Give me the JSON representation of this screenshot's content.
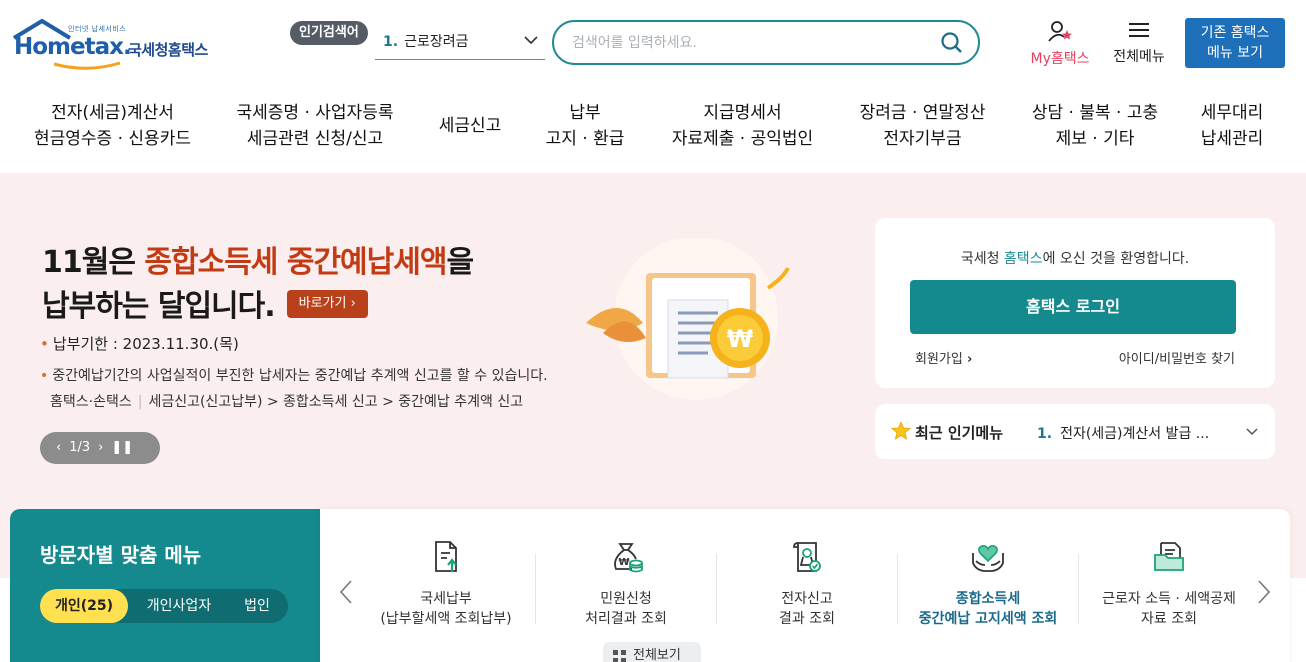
{
  "header": {
    "logo_small": "인터넷 납세서비스",
    "logo_main": "Hometax.",
    "logo_name": "국세청홈택스",
    "popular_badge": "인기검색어",
    "popular_rank": "1.",
    "popular_term": "근로장려금",
    "search_placeholder": "검색어를 입력하세요.",
    "my_hometax": "My홈택스",
    "all_menu": "전체메뉴",
    "old_hometax_line1": "기존 홈택스",
    "old_hometax_line2": "메뉴 보기"
  },
  "gnb": [
    {
      "line1": "전자(세금)계산서",
      "line2": "현금영수증 · 신용카드"
    },
    {
      "line1": "국세증명 · 사업자등록",
      "line2": "세금관련 신청/신고"
    },
    {
      "line1": "세금신고",
      "line2": ""
    },
    {
      "line1": "납부",
      "line2": "고지 · 환급"
    },
    {
      "line1": "지급명세서",
      "line2": "자료제출 · 공익법인"
    },
    {
      "line1": "장려금 · 연말정산",
      "line2": "전자기부금"
    },
    {
      "line1": "상담 · 불복 · 고충",
      "line2": "제보 · 기타"
    },
    {
      "line1": "세무대리",
      "line2": "납세관리"
    }
  ],
  "hero": {
    "title_a": "11월은 ",
    "title_hl": "종합소득세 중간예납세액",
    "title_b": "을",
    "title_line2": "납부하는 달입니다.",
    "go_button": "바로가기",
    "due_label": "납부기한 : ",
    "due_date": "2023.11.30.(목)",
    "desc": "중간예납기간의 사업실적이 부진한 납세자는 중간예납 추계액 신고를 할 수 있습니다.",
    "path_a": "홈택스·손택스",
    "path_b": "세금신고(신고납부) > 종합소득세 신고 > 중간예납 추계액 신고",
    "pager": "1/3"
  },
  "login": {
    "welcome_a": "국세청 ",
    "welcome_hl": "홈택스",
    "welcome_b": "에 오신 것을 환영합니다.",
    "login_button": "홈택스 로그인",
    "join": "회원가입",
    "find": "아이디/비밀번호 찾기"
  },
  "recent": {
    "label": "최근 인기메뉴",
    "rank": "1.",
    "value": "전자(세금)계산서 발급 ..."
  },
  "visitor": {
    "title": "방문자별 맞춤 메뉴",
    "tabs": [
      "개인(25)",
      "개인사업자",
      "법인"
    ]
  },
  "quick": [
    {
      "icon": "document-upload-icon",
      "line1": "국세납부",
      "line2": "(납부할세액 조회납부)"
    },
    {
      "icon": "money-bag-icon",
      "line1": "민원신청",
      "line2": "처리결과 조회"
    },
    {
      "icon": "certificate-icon",
      "line1": "전자신고",
      "line2": "결과 조회"
    },
    {
      "icon": "hands-heart-icon",
      "line1": "종합소득세",
      "line2": "중간예납 고지세액 조회"
    },
    {
      "icon": "folder-document-icon",
      "line1": "근로자 소득 · 세액공제",
      "line2": "자료 조회"
    }
  ],
  "view_all": "전체보기",
  "colors": {
    "teal": "#148a8e",
    "hero_bg": "#fbeeee",
    "highlight": "#c23b14",
    "blue": "#1c6fb8",
    "yellow": "#ffe04f"
  }
}
